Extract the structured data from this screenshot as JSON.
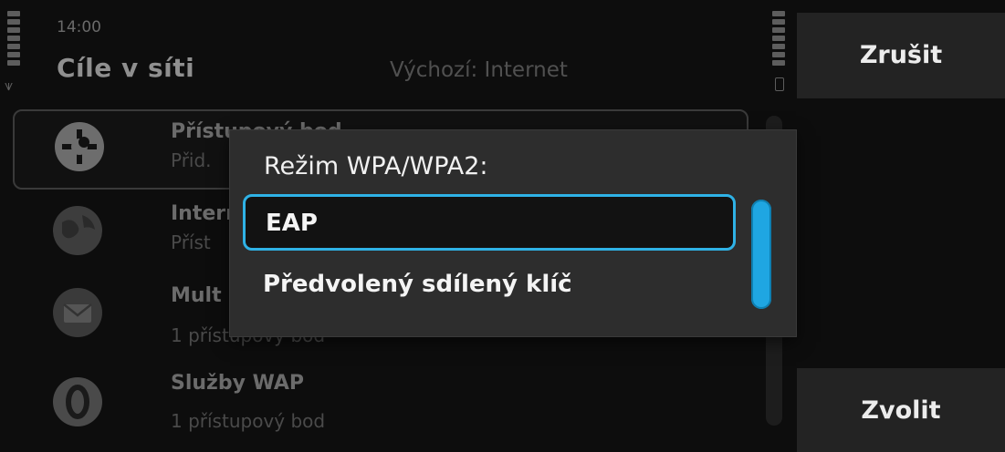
{
  "status": {
    "time": "14:00"
  },
  "header": {
    "title": "Cíle v síti",
    "default_network": "Výchozí: Internet"
  },
  "list": {
    "items": [
      {
        "title": "Přístupový bod",
        "subtitle": "Přid.",
        "icon": "globe-plus-icon"
      },
      {
        "title": "Internet",
        "subtitle": "Příst",
        "icon": "globe-icon"
      },
      {
        "title": "Mult",
        "subtitle": "1 přístupový bod",
        "icon": "mms-icon"
      },
      {
        "title": "Služby WAP",
        "subtitle": "1 přístupový bod",
        "icon": "wap-icon"
      }
    ]
  },
  "dialog": {
    "title": "Režim WPA/WPA2:",
    "options": [
      "EAP",
      "Předvolený sdílený klíč"
    ],
    "selected_index": 0,
    "accent_color": "#2fb2e6"
  },
  "softkeys": {
    "cancel": "Zrušit",
    "select": "Zvolit"
  }
}
